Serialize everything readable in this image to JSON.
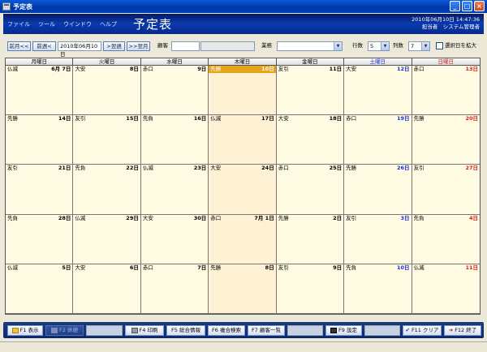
{
  "window": {
    "title": "予定表"
  },
  "menu": [
    "ファイル",
    "ツール",
    "ウインドウ",
    "ヘルプ"
  ],
  "header": {
    "app_title": "予定表",
    "datetime": "2010年06月10日 14:47:36",
    "user": "担当者　システム管理者"
  },
  "toolbar": {
    "prev_month": "前月<<",
    "prev_week": "前週<",
    "date_value": "2010年06月10日",
    "next_week": ">翌週",
    "next_month": ">>翌月",
    "customer_label": "顧客",
    "customer_value": "",
    "customer_name": "",
    "business_label": "業務",
    "business_value": "",
    "rows_label": "行数",
    "rows_value": "5",
    "cols_label": "列数",
    "cols_value": "7",
    "expand_label": "選択日を拡大"
  },
  "calendar": {
    "weekdays": [
      "月曜日",
      "火曜日",
      "水曜日",
      "木曜日",
      "金曜日",
      "土曜日",
      "日曜日"
    ],
    "weeks": [
      [
        {
          "rokuyo": "仏滅",
          "day": "6月 7日"
        },
        {
          "rokuyo": "大安",
          "day": "8日"
        },
        {
          "rokuyo": "赤口",
          "day": "9日"
        },
        {
          "rokuyo": "先勝",
          "day": "10日"
        },
        {
          "rokuyo": "友引",
          "day": "11日"
        },
        {
          "rokuyo": "大安",
          "day": "12日"
        },
        {
          "rokuyo": "赤口",
          "day": "13日"
        }
      ],
      [
        {
          "rokuyo": "先勝",
          "day": "14日"
        },
        {
          "rokuyo": "友引",
          "day": "15日"
        },
        {
          "rokuyo": "先負",
          "day": "16日"
        },
        {
          "rokuyo": "仏滅",
          "day": "17日"
        },
        {
          "rokuyo": "大安",
          "day": "18日"
        },
        {
          "rokuyo": "赤口",
          "day": "19日"
        },
        {
          "rokuyo": "先勝",
          "day": "20日"
        }
      ],
      [
        {
          "rokuyo": "友引",
          "day": "21日"
        },
        {
          "rokuyo": "先負",
          "day": "22日"
        },
        {
          "rokuyo": "仏滅",
          "day": "23日"
        },
        {
          "rokuyo": "大安",
          "day": "24日"
        },
        {
          "rokuyo": "赤口",
          "day": "25日"
        },
        {
          "rokuyo": "先勝",
          "day": "26日"
        },
        {
          "rokuyo": "友引",
          "day": "27日"
        }
      ],
      [
        {
          "rokuyo": "先負",
          "day": "28日"
        },
        {
          "rokuyo": "仏滅",
          "day": "29日"
        },
        {
          "rokuyo": "大安",
          "day": "30日"
        },
        {
          "rokuyo": "赤口",
          "day": "7月 1日"
        },
        {
          "rokuyo": "先勝",
          "day": "2日"
        },
        {
          "rokuyo": "友引",
          "day": "3日"
        },
        {
          "rokuyo": "先負",
          "day": "4日"
        }
      ],
      [
        {
          "rokuyo": "仏滅",
          "day": "5日"
        },
        {
          "rokuyo": "大安",
          "day": "6日"
        },
        {
          "rokuyo": "赤口",
          "day": "7日"
        },
        {
          "rokuyo": "先勝",
          "day": "8日"
        },
        {
          "rokuyo": "友引",
          "day": "9日"
        },
        {
          "rokuyo": "先負",
          "day": "10日"
        },
        {
          "rokuyo": "仏滅",
          "day": "11日"
        }
      ]
    ],
    "today": {
      "week": 0,
      "col": 3
    },
    "colors": {
      "today": "#e8a418",
      "saturday": "#1d2fd6",
      "sunday": "#d81c1c",
      "cell_bg": "#fffbe3"
    }
  },
  "fkeys": {
    "f1": "F1 表示",
    "f2": "F2 休憩",
    "f4": "F4 印刷",
    "f5": "F5 総合情報",
    "f6": "F6 複合検索",
    "f7": "F7 顧客一覧",
    "f9": "F9 設定",
    "f11": "F11 クリア",
    "f12": "F12 終了"
  }
}
